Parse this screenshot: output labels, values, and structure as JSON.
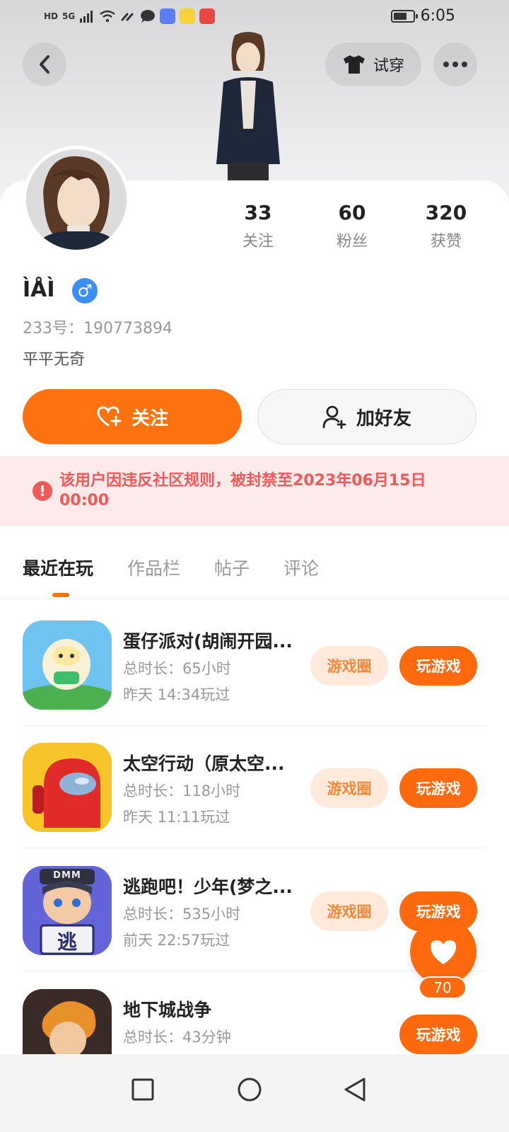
{
  "status_bar": {
    "time": "6:05",
    "hd_label": "HD",
    "network_label": "5G"
  },
  "header": {
    "try_on_label": "试穿"
  },
  "stats": [
    {
      "value": "33",
      "label": "关注"
    },
    {
      "value": "60",
      "label": "粉丝"
    },
    {
      "value": "320",
      "label": "获赞"
    }
  ],
  "profile": {
    "username": "ÌÅÌ",
    "gender_symbol": "♂",
    "uid": "233号：190773894",
    "bio": "平平无奇"
  },
  "actions": {
    "follow_label": "关注",
    "add_friend_label": "加好友"
  },
  "ban_notice": {
    "text": "该用户因违反社区规则，被封禁至2023年06月15日 00:00"
  },
  "tabs": [
    {
      "label": "最近在玩",
      "active": true
    },
    {
      "label": "作品栏",
      "active": false
    },
    {
      "label": "帖子",
      "active": false
    },
    {
      "label": "评论",
      "active": false
    }
  ],
  "games": [
    {
      "title": "蛋仔派对(胡闹开园...",
      "duration": "总时长：65小时",
      "last_played": "昨天 14:34玩过",
      "circle_label": "游戏圈",
      "play_label": "玩游戏"
    },
    {
      "title": "太空行动（原太空...",
      "duration": "总时长：118小时",
      "last_played": "昨天 11:11玩过",
      "circle_label": "游戏圈",
      "play_label": "玩游戏"
    },
    {
      "title": "逃跑吧！少年(梦之...",
      "duration": "总时长：535小时",
      "last_played": "前天 22:57玩过",
      "circle_label": "游戏圈",
      "play_label": "玩游戏",
      "icon_text": "逃",
      "icon_tag": "DMM"
    },
    {
      "title": "地下城战争",
      "duration": "总时长：43分钟",
      "last_played": "",
      "circle_label": "",
      "play_label": "玩游戏"
    }
  ],
  "like_fab": {
    "count": "70"
  },
  "colors": {
    "accent": "#ff6a0e",
    "ban_text": "#f25a5a",
    "ban_bg": "#fdeaea",
    "gender": "#3a8ef6"
  }
}
